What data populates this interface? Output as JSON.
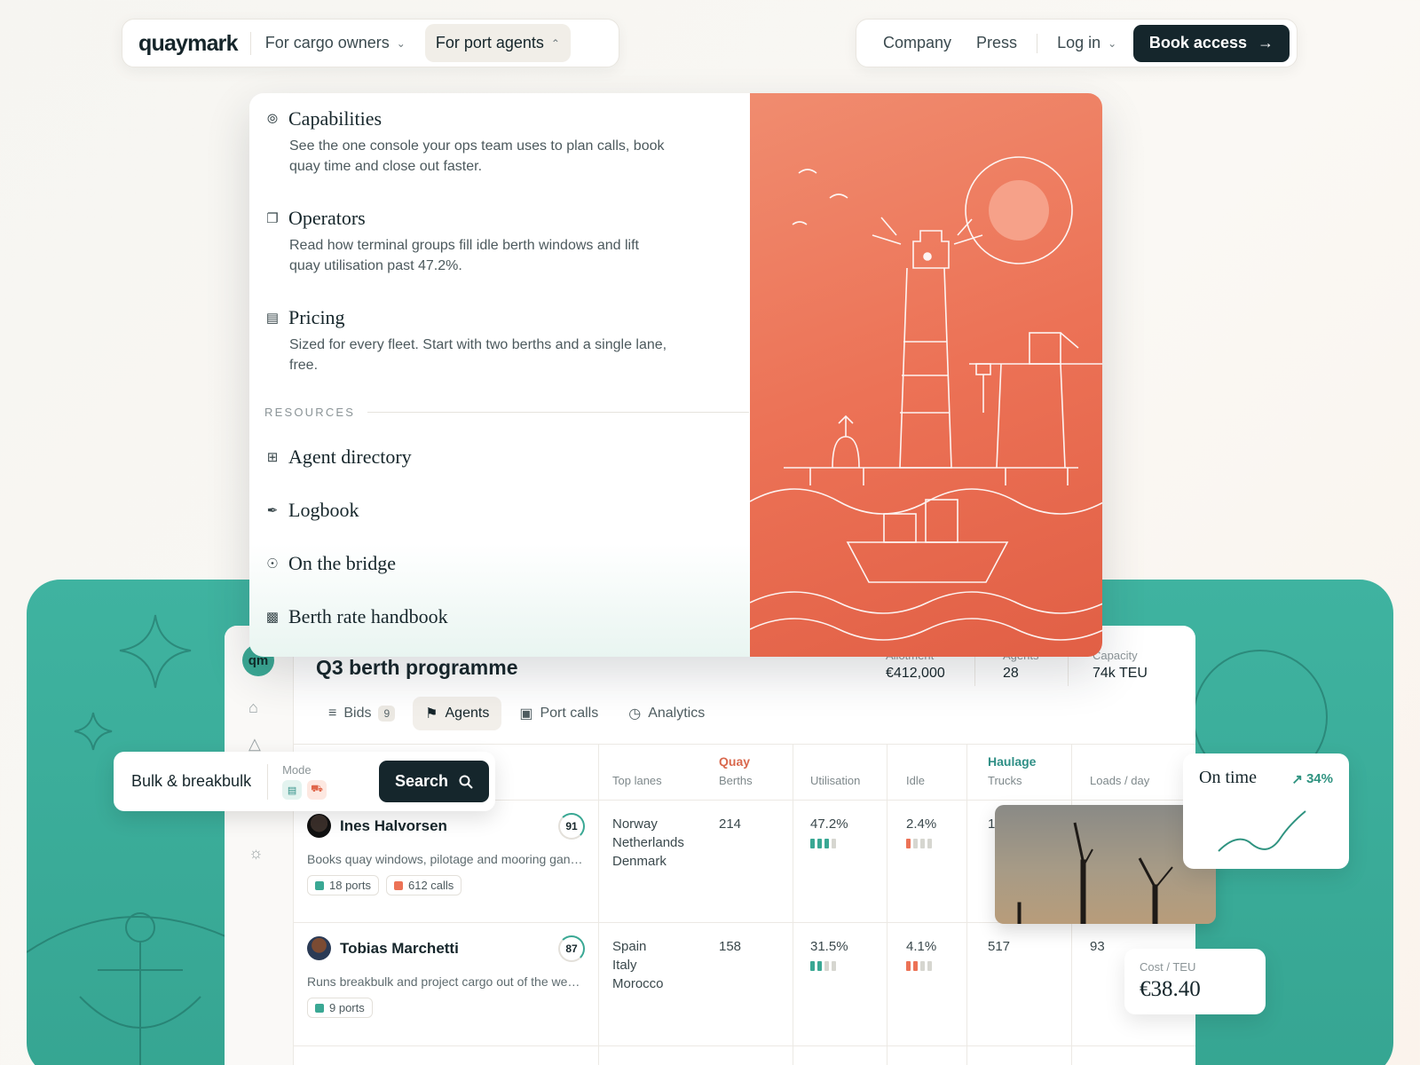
{
  "brand": {
    "logo": "quaymark"
  },
  "nav": {
    "cargo": "For cargo owners",
    "agents": "For port agents",
    "company": "Company",
    "press": "Press",
    "login": "Log in",
    "book": "Book access"
  },
  "menu": {
    "items": [
      {
        "title": "Capabilities",
        "icon": "compass-icon",
        "desc": "See the one console your ops team uses to plan calls, book quay time and close out faster."
      },
      {
        "title": "Operators",
        "icon": "cards-icon",
        "desc": "Read how terminal groups fill idle berth windows and lift quay utilisation past 47.2%."
      },
      {
        "title": "Pricing",
        "icon": "wallet-icon",
        "desc": "Sized for every fleet. Start with two berths and a single lane, free."
      }
    ],
    "resources_label": "RESOURCES",
    "resources": [
      {
        "title": "Agent directory",
        "icon": "grid-icon"
      },
      {
        "title": "Logbook",
        "icon": "feather-icon"
      },
      {
        "title": "On the bridge",
        "icon": "microphone-icon"
      },
      {
        "title": "Berth rate handbook",
        "icon": "document-icon"
      }
    ]
  },
  "app": {
    "avatar": "qm",
    "title": "Q3 berth programme",
    "stats": [
      {
        "label": "Allotment",
        "value": "€412,000"
      },
      {
        "label": "Agents",
        "value": "28"
      },
      {
        "label": "Capacity",
        "value": "74k TEU"
      }
    ],
    "tabs": [
      {
        "label": "Bids",
        "count": "9"
      },
      {
        "label": "Agents"
      },
      {
        "label": "Port calls"
      },
      {
        "label": "Analytics"
      }
    ],
    "columns": {
      "lanes": "Top lanes",
      "quay_group": "Quay",
      "berths": "Berths",
      "utilisation": "Utilisation",
      "idle": "Idle",
      "haulage_group": "Haulage",
      "trucks": "Trucks",
      "loads": "Loads / day"
    },
    "rows": [
      {
        "name": "Ines Halvorsen",
        "score": "91",
        "desc": "Books quay windows, pilotage and mooring gangs across the North Sea range for bulk...",
        "chips": [
          "18 ports",
          "612 calls"
        ],
        "lanes": [
          "Norway",
          "Netherlands",
          "Denmark"
        ],
        "berths": "214",
        "util": "47.2%",
        "util_level": 3,
        "idle": "2.4%",
        "idle_level": 1,
        "trucks": "1",
        "loads": ""
      },
      {
        "name": "Tobias Marchetti",
        "score": "87",
        "desc": "Runs breakbulk and project cargo out of the western Med, including inland barge legs an...",
        "chips": [
          "9 ports"
        ],
        "lanes": [
          "Spain",
          "Italy",
          "Morocco"
        ],
        "berths": "158",
        "util": "31.5%",
        "util_level": 2,
        "idle": "4.1%",
        "idle_level": 2,
        "trucks": "517",
        "loads": "93"
      }
    ]
  },
  "search": {
    "value": "Bulk & breakbulk",
    "mode_label": "Mode",
    "button": "Search"
  },
  "ontime": {
    "label": "On time",
    "delta": "34%"
  },
  "cost": {
    "label": "Cost / TEU",
    "value": "€38.40"
  },
  "colors": {
    "teal": "#3aa894",
    "coral": "#ec7256",
    "ink": "#15262c"
  }
}
